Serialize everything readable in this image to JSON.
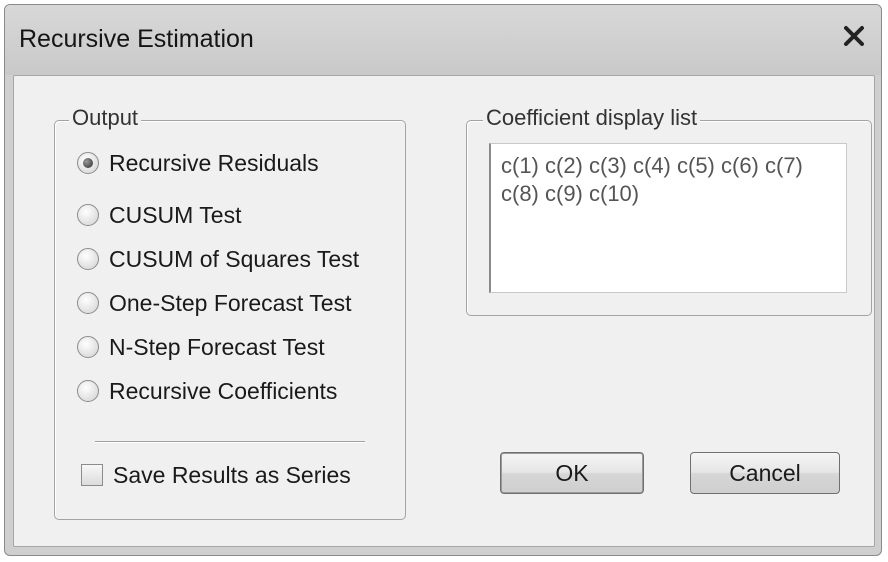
{
  "window": {
    "title": "Recursive Estimation",
    "close_icon": "close-icon"
  },
  "output_group": {
    "legend": "Output",
    "selected": "Recursive Residuals",
    "options": [
      "Recursive Residuals",
      "CUSUM Test",
      "CUSUM of Squares Test",
      "One-Step Forecast Test",
      "N-Step Forecast Test",
      "Recursive Coefficients"
    ],
    "save_checkbox": {
      "label": "Save Results as Series",
      "checked": false
    }
  },
  "coefficient_group": {
    "legend": "Coefficient display list",
    "value": "c(1) c(2) c(3) c(4) c(5) c(6) c(7) c(8) c(9) c(10)"
  },
  "buttons": {
    "ok": "OK",
    "cancel": "Cancel"
  }
}
